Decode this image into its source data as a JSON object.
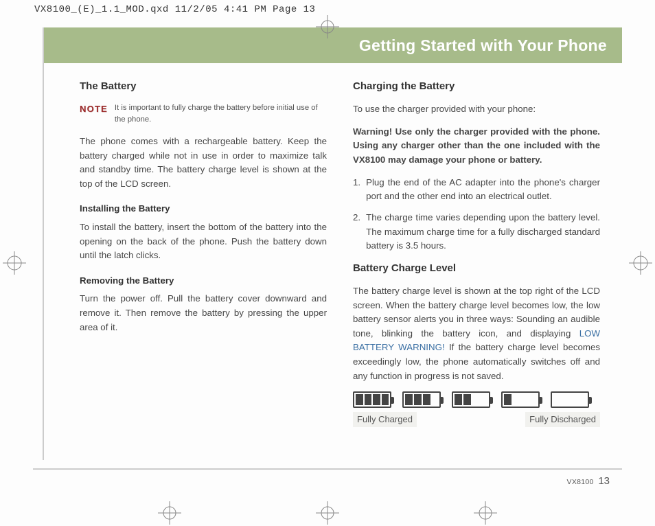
{
  "header_strip": "VX8100_(E)_1.1_MOD.qxd  11/2/05  4:41 PM  Page 13",
  "banner_title": "Getting Started with Your Phone",
  "left": {
    "h_battery": "The Battery",
    "note_label": "NOTE",
    "note_text": "It is important to fully charge the battery before initial use of the phone.",
    "p1": "The phone comes with a rechargeable battery. Keep the battery charged while not in use in order to maximize talk and standby time. The battery charge level is shown at the top of the LCD screen.",
    "h_install": "Installing the Battery",
    "p_install": "To install the battery, insert the bottom of the battery into the opening on the back of the phone. Push the battery down until the latch clicks.",
    "h_remove": "Removing the Battery",
    "p_remove": "Turn the power off. Pull the battery cover downward and remove it. Then remove the battery by pressing the upper area of it."
  },
  "right": {
    "h_charge": "Charging the Battery",
    "p_charge_intro": "To use the charger provided with your phone:",
    "p_warning": "Warning! Use only the charger provided with the phone. Using any charger other than the one included with the VX8100 may damage your phone or battery.",
    "steps": [
      "Plug the end of the AC adapter into the phone's charger port and the other end into an electrical outlet.",
      "The charge time varies depending upon the battery level. The maximum charge time for a fully discharged standard battery is 3.5 hours."
    ],
    "h_level": "Battery Charge Level",
    "p_level_a": "The battery charge level is shown at the top right of the LCD screen. When the battery charge level becomes low, the low battery sensor alerts you in three ways: Sounding an audible tone, blinking the battery icon, and displaying ",
    "p_level_warn": "LOW BATTERY WARNING!",
    "p_level_b": " If the battery charge level becomes exceedingly low, the phone automatically switches off and any function in progress is not saved.",
    "label_full": "Fully Charged",
    "label_empty": "Fully Discharged"
  },
  "footer": {
    "model": "VX8100",
    "page": "13"
  },
  "battery_levels": [
    4,
    3,
    2,
    1,
    0
  ]
}
